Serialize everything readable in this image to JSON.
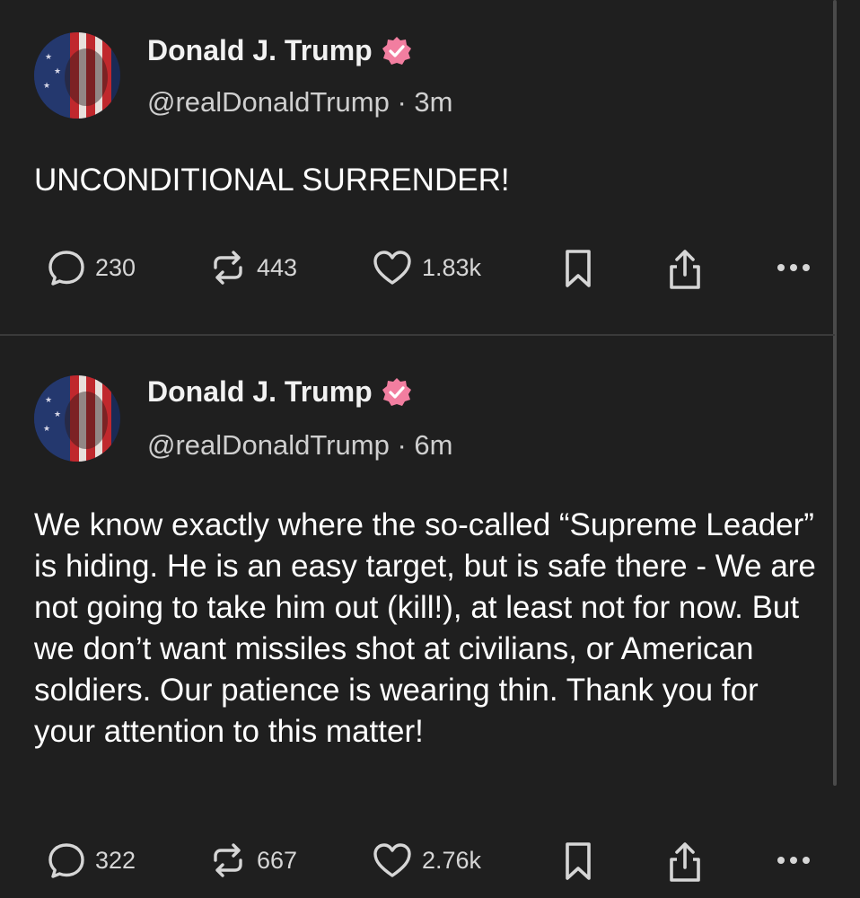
{
  "posts": [
    {
      "author": {
        "display_name": "Donald J. Trump",
        "handle": "@realDonaldTrump",
        "time": "3m",
        "verified": true
      },
      "body": "UNCONDITIONAL SURRENDER!",
      "stats": {
        "replies": "230",
        "reposts": "443",
        "likes": "1.83k"
      }
    },
    {
      "author": {
        "display_name": "Donald J. Trump",
        "handle": "@realDonaldTrump",
        "time": "6m",
        "verified": true
      },
      "body": "We know exactly where the so-called “Supreme Leader” is hiding. He is an easy target, but is safe there - We are not going to take him out (kill!), at least not for now. But we don’t want missiles shot at civilians, or American soldiers. Our patience is wearing thin. Thank you for your attention to this matter!",
      "stats": {
        "replies": "322",
        "reposts": "667",
        "likes": "2.76k"
      }
    }
  ],
  "icons": {
    "reply": "reply-bubble-icon",
    "repost": "repost-arrows-icon",
    "like": "heart-icon",
    "bookmark": "bookmark-icon",
    "share": "share-icon",
    "more": "more-dots-icon",
    "verified": "verified-badge-icon"
  },
  "colors": {
    "background": "#1f1f1f",
    "verified_badge": "#f27ea0",
    "text_primary": "#ffffff",
    "text_secondary": "#cfcfcf",
    "divider": "#3a3a3a"
  }
}
